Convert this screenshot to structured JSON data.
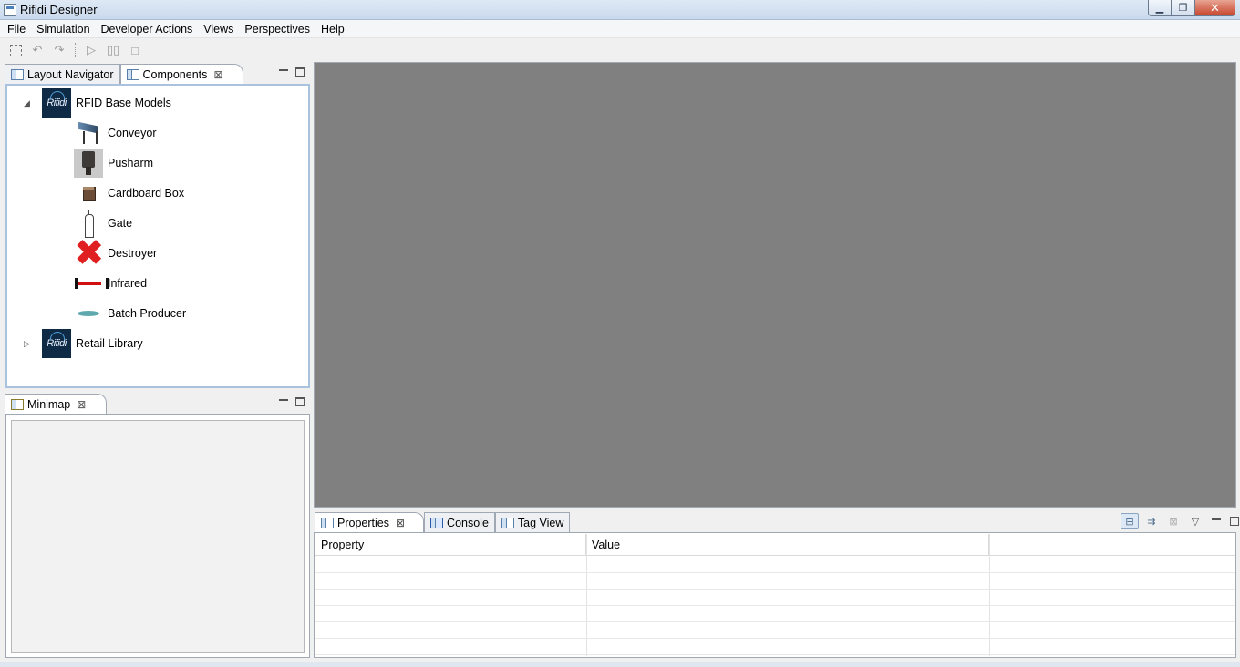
{
  "window": {
    "title": "Rifidi Designer"
  },
  "menu": [
    "File",
    "Simulation",
    "Developer Actions",
    "Views",
    "Perspectives",
    "Help"
  ],
  "toolbar": {
    "icons": [
      "select-icon",
      "undo-icon",
      "redo-icon",
      "play-icon",
      "pause-icon",
      "stop-icon"
    ]
  },
  "left_top_panel": {
    "tabs": [
      {
        "label": "Layout Navigator",
        "active": false
      },
      {
        "label": "Components",
        "active": true
      }
    ],
    "tree": {
      "groups": [
        {
          "label": "RFID Base Models",
          "expanded": true,
          "logo_text": "Rifidi",
          "items": [
            {
              "label": "Conveyor",
              "icon": "conveyor-icon"
            },
            {
              "label": "Pusharm",
              "icon": "pusharm-icon"
            },
            {
              "label": "Cardboard Box",
              "icon": "cardboard-box-icon"
            },
            {
              "label": "Gate",
              "icon": "gate-icon"
            },
            {
              "label": "Destroyer",
              "icon": "destroyer-icon"
            },
            {
              "label": "Infrared",
              "icon": "infrared-icon"
            },
            {
              "label": "Batch Producer",
              "icon": "batch-producer-icon"
            }
          ]
        },
        {
          "label": "Retail Library",
          "expanded": false,
          "logo_text": "Rifidi"
        }
      ]
    }
  },
  "left_bottom_panel": {
    "tabs": [
      {
        "label": "Minimap",
        "active": true
      }
    ]
  },
  "bottom_panel": {
    "tabs": [
      {
        "label": "Properties",
        "active": true
      },
      {
        "label": "Console",
        "active": false
      },
      {
        "label": "Tag View",
        "active": false
      }
    ],
    "table": {
      "columns": [
        "Property",
        "Value",
        ""
      ],
      "rows": []
    }
  },
  "colors": {
    "editor_bg": "#808080",
    "destroyer": "#e02020",
    "infrared_beam": "#d01010",
    "batch": "#5fa8ad"
  }
}
